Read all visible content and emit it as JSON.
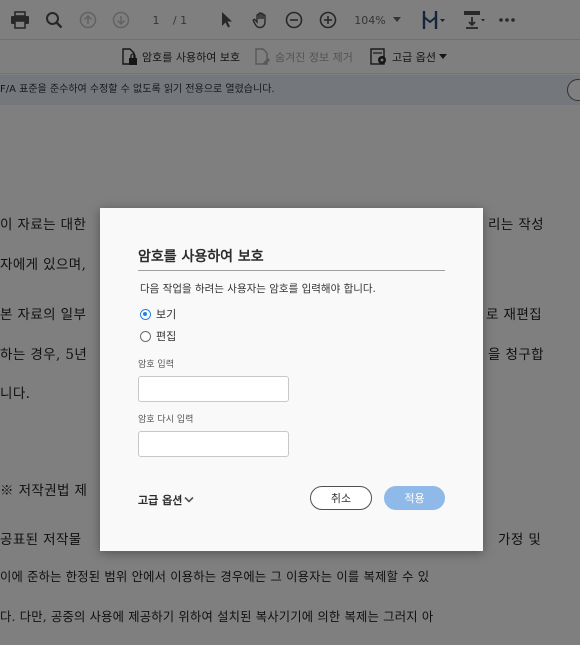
{
  "toolbar": {
    "page_current": "1",
    "page_total": "/ 1",
    "zoom": "104%",
    "icons": [
      "print-icon",
      "search-icon",
      "page-up-icon",
      "page-down-icon",
      "select-cursor-icon",
      "hand-icon",
      "zoom-out-icon",
      "zoom-in-icon",
      "page-fit-icon",
      "scroll-mode-icon",
      "more-icon"
    ]
  },
  "subbar": {
    "protect_label": "암호를 사용하여 보호",
    "remove_hidden_label": "숨겨진 정보 제거",
    "advanced_label": "고급 옵션"
  },
  "infobar": {
    "message": "F/A 표준을 준수하여 수정할 수 없도록 읽기 전용으로 열렸습니다."
  },
  "document": {
    "lines": [
      "이 자료는 대한",
      "리는 작성",
      "자에게 있으며,",
      "본 자료의 일부",
      "로 재편집",
      "하는 경우, 5년",
      "을 청구합",
      "니다.",
      "※ 저작권법 제",
      "공표된 저작물",
      "가정 및",
      "이에 준하는 한정된 범위 안에서 이용하는 경우에는 그 이용자는 이를 복제할 수 있",
      "다. 다만, 공중의 사용에 제공하기 위하여 설치된 복사기기에 의한 복제는 그러지 아"
    ]
  },
  "dialog": {
    "title": "암호를 사용하여 보호",
    "description": "다음 작업을 하려는 사용자는 암호를 입력해야 합니다.",
    "option_view": "보기",
    "option_edit": "편집",
    "password_label": "암호 입력",
    "password_value": "",
    "confirm_label": "암호 다시 입력",
    "confirm_value": "",
    "advanced_label": "고급 옵션",
    "cancel_label": "취소",
    "apply_label": "적용",
    "selected_option": "보기",
    "accent_color": "#2680eb",
    "apply_color": "#8fb9e8"
  }
}
